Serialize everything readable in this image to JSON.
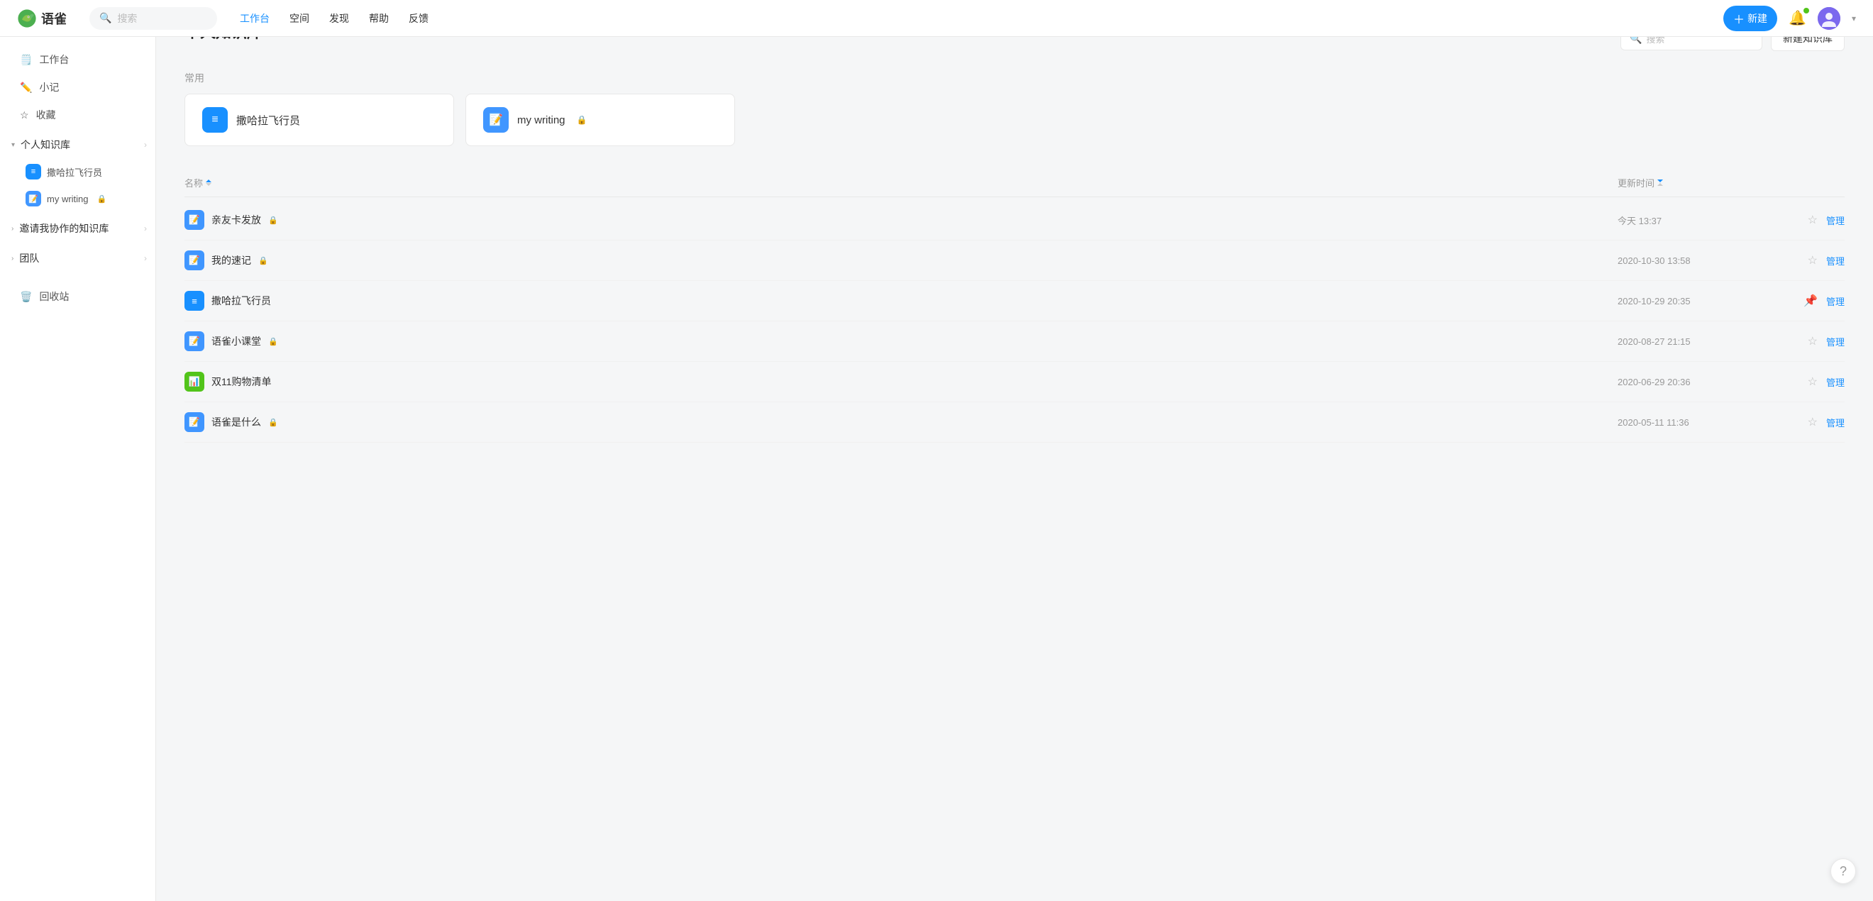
{
  "app": {
    "name": "语雀",
    "logo_text": "语雀"
  },
  "topnav": {
    "search_placeholder": "搜索",
    "links": [
      {
        "label": "工作台",
        "active": true
      },
      {
        "label": "空间",
        "active": false
      },
      {
        "label": "发现",
        "active": false
      },
      {
        "label": "帮助",
        "active": false
      },
      {
        "label": "反馈",
        "active": false
      }
    ],
    "new_btn": "新建"
  },
  "sidebar": {
    "items": [
      {
        "label": "工作台",
        "icon": "desk"
      },
      {
        "label": "小记",
        "icon": "note"
      },
      {
        "label": "收藏",
        "icon": "star"
      }
    ],
    "groups": [
      {
        "label": "个人知识库",
        "expanded": true,
        "children": [
          {
            "label": "撒哈拉飞行员",
            "icon": "book"
          },
          {
            "label": "my writing",
            "icon": "note",
            "locked": true
          }
        ]
      },
      {
        "label": "邀请我协作的知识库",
        "expanded": false,
        "children": []
      },
      {
        "label": "团队",
        "expanded": false,
        "children": []
      }
    ],
    "trash": "回收站"
  },
  "main": {
    "title": "个人知识库",
    "new_kb_btn": "新建知识库",
    "search_placeholder": "搜索",
    "common_label": "常用",
    "common_kbs": [
      {
        "label": "撒哈拉飞行员",
        "icon": "book",
        "locked": false
      },
      {
        "label": "my writing",
        "icon": "note",
        "locked": true
      }
    ],
    "table": {
      "col_name": "名称",
      "col_time": "更新时间",
      "rows": [
        {
          "name": "亲友卡发放",
          "icon": "note",
          "locked": true,
          "time": "今天 13:37",
          "pinned": false,
          "manage": "管理"
        },
        {
          "name": "我的速记",
          "icon": "note",
          "locked": true,
          "time": "2020-10-30 13:58",
          "pinned": false,
          "manage": "管理"
        },
        {
          "name": "撒哈拉飞行员",
          "icon": "book",
          "locked": false,
          "time": "2020-10-29 20:35",
          "pinned": true,
          "manage": "管理"
        },
        {
          "name": "语雀小课堂",
          "icon": "note",
          "locked": true,
          "time": "2020-08-27 21:15",
          "pinned": false,
          "manage": "管理"
        },
        {
          "name": "双11购物清单",
          "icon": "chart",
          "locked": false,
          "time": "2020-06-29 20:36",
          "pinned": false,
          "manage": "管理"
        },
        {
          "name": "语雀是什么",
          "icon": "note",
          "locked": true,
          "time": "2020-05-11 11:36",
          "pinned": false,
          "manage": "管理"
        }
      ]
    }
  },
  "help": "?"
}
